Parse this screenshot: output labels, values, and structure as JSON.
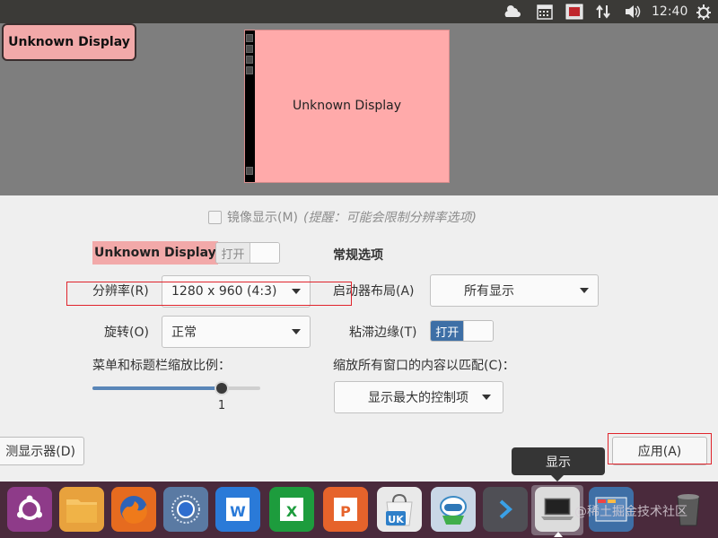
{
  "top_panel": {
    "clock": "12:40",
    "icons": [
      "weather-icon",
      "calendar-icon",
      "recording-icon",
      "network-icon",
      "volume-icon",
      "power-icon"
    ]
  },
  "preview": {
    "display_tag": "Unknown Display",
    "monitor_label": "Unknown Display"
  },
  "mirror": {
    "label": "镜像显示(M)",
    "hint": "(提醒：可能会限制分辨率选项)"
  },
  "display": {
    "name": "Unknown Display",
    "toggle_label": "打开",
    "resolution_label": "分辨率(R)",
    "resolution_value": "1280 x 960 (4:3)",
    "rotation_label": "旋转(O)",
    "rotation_value": "正常",
    "scale_label": "菜单和标题栏缩放比例：",
    "scale_value": "1",
    "scale_fraction": 0.76
  },
  "general": {
    "title": "常规选项",
    "launcher_label": "启动器布局(A)",
    "launcher_value": "所有显示",
    "sticky_label": "粘滞边缘(T)",
    "sticky_toggle": "打开",
    "fit_label": "缩放所有窗口的内容以匹配(C)：",
    "fit_value": "显示最大的控制项"
  },
  "buttons": {
    "detect": "测显示器(D)",
    "apply": "应用(A)"
  },
  "tooltip": "显示",
  "launcher_items": [
    "ubuntu-logo-icon",
    "files-icon",
    "firefox-icon",
    "chromium-icon",
    "writer-icon",
    "calc-icon",
    "impress-icon",
    "software-center-icon",
    "ubuntu-kylin-icon",
    "terminal-icon",
    "display-settings-icon",
    "workspace-switcher-icon",
    "trash-icon"
  ],
  "watermark": "@稀土掘金技术社区",
  "colors": {
    "display_highlight": "#f2a9a9",
    "accent": "#3e6fa6",
    "annotation_red": "#e0242c",
    "launcher_bg": "#4a2a3c"
  }
}
